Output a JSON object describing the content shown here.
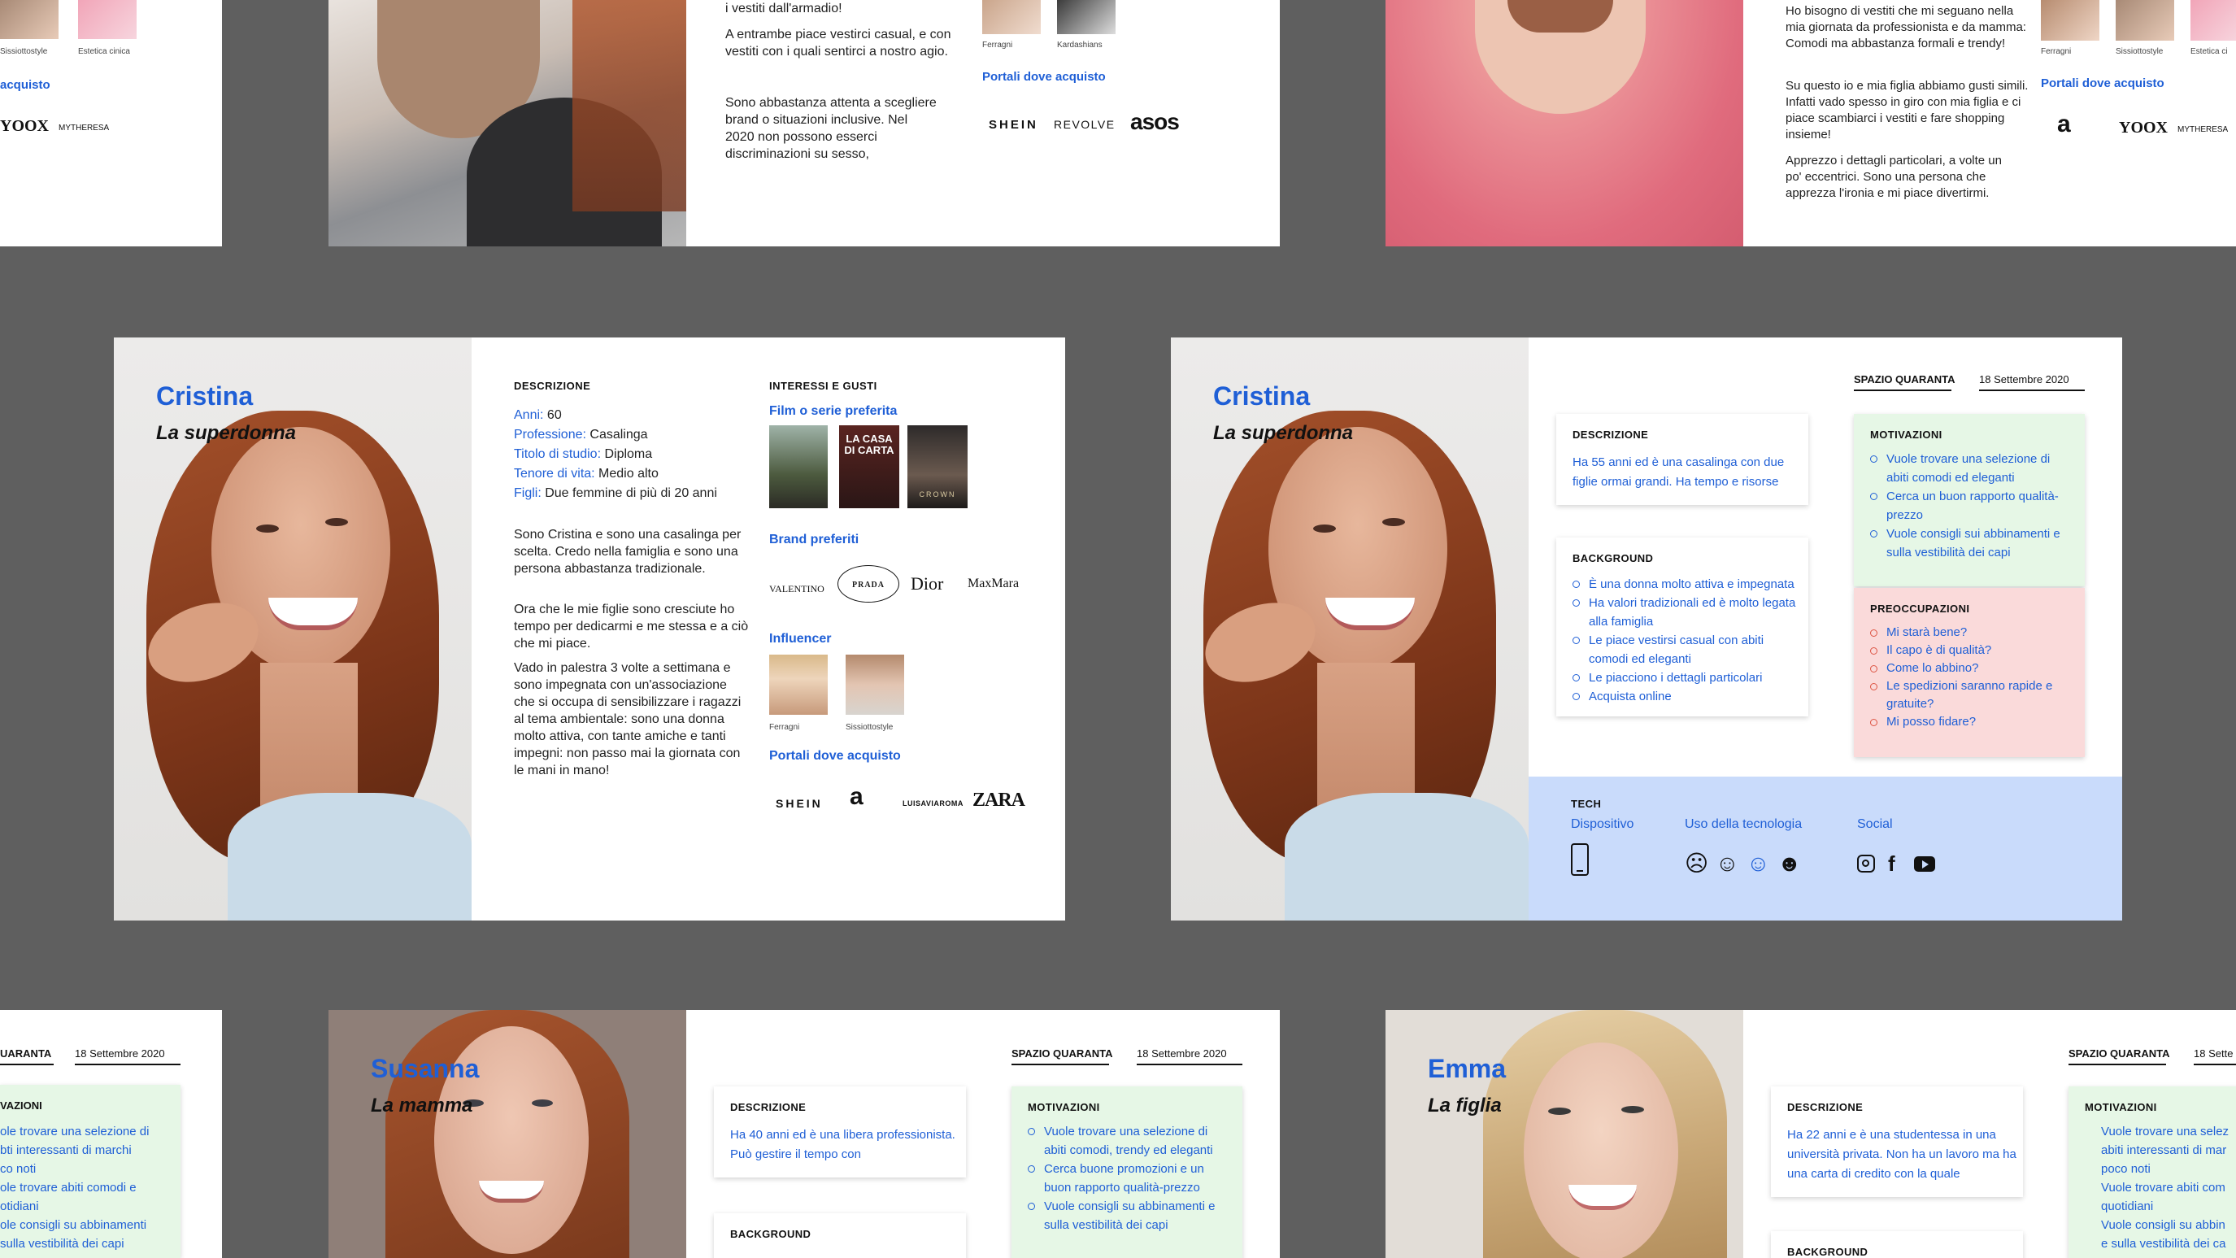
{
  "top_left": {
    "caption_1": "Sissiottostyle",
    "caption_2": "Estetica cinica",
    "link": "acquisto",
    "logos": [
      "YOOX",
      "MYTHERESA"
    ]
  },
  "top_mid": {
    "para_1": "i vestiti dall'armadio!",
    "para_2": "A entrambe piace vestirci casual, e con vestiti con i quali sentirci a nostro agio.",
    "para_3": "Sono abbastanza attenta a scegliere brand o situazioni inclusive. Nel 2020 non possono esserci discriminazioni su sesso,",
    "captions": [
      "Ferragni",
      "Kardashians"
    ],
    "link": "Portali dove acquisto",
    "logos": [
      "SHEIN",
      "REVOLVE",
      "asos"
    ]
  },
  "top_right": {
    "para_1": "Ho bisogno di vestiti che mi seguano nella mia giornata da professionista e da mamma: Comodi ma abbastanza formali e trendy!",
    "para_2": "Su questo io e mia figlia abbiamo gusti simili. Infatti vado spesso in giro con mia figlia e ci piace scambiarci i vestiti e fare shopping insieme!",
    "para_3": "Apprezzo i dettagli particolari, a volte un po' eccentrici. Sono una persona che apprezza l'ironia e mi piace divertirmi.",
    "captions": [
      "Ferragni",
      "Sissiottostyle",
      "Estetica ci"
    ],
    "link": "Portali dove acquisto",
    "logos": [
      "a",
      "YOOX",
      "MYTHERESA"
    ]
  },
  "cristina_profile": {
    "name": "Cristina",
    "subtitle": "La superdonna",
    "desc_head": "DESCRIZIONE",
    "fields": [
      {
        "label": "Anni:",
        "value": " 60"
      },
      {
        "label": "Professione:",
        "value": " Casalinga"
      },
      {
        "label": "Titolo di studio:",
        "value": " Diploma"
      },
      {
        "label": "Tenore di vita:",
        "value": " Medio alto"
      },
      {
        "label": "Figli:",
        "value": " Due femmine di più di 20 anni"
      }
    ],
    "bio_1": "Sono Cristina e sono una casalinga per scelta. Credo nella famiglia e sono una persona abbastanza tradizionale.",
    "bio_2": "Ora che le mie figlie sono cresciute ho tempo per dedicarmi e me stessa e a ciò che mi piace.",
    "bio_3": "Vado in palestra 3 volte a settimana e sono impegnata con un'associazione che si occupa di sensibilizzare i ragazzi al tema ambientale: sono una donna molto attiva, con tante amiche e tanti impegni: non passo mai la giornata con le mani in mano!",
    "int_head": "INTERESSI E GUSTI",
    "films_label": "Film o serie preferita",
    "film_2": "LA CASA DI CARTA",
    "film_3": "CROWN",
    "brands_label": "Brand preferiti",
    "brands": [
      "VALENTINO",
      "PRADA",
      "Dior",
      "MaxMara"
    ],
    "influencer_label": "Influencer",
    "influencers": [
      "Ferragni",
      "Sissiottostyle"
    ],
    "portals_label": "Portali dove acquisto",
    "portals": [
      "SHEIN",
      "a",
      "LUISAVIAROMA",
      "ZARA"
    ]
  },
  "cristina_summary": {
    "name": "Cristina",
    "subtitle": "La superdonna",
    "brand": "SPAZIO QUARANTA",
    "date": "18 Settembre 2020",
    "desc_head": "DESCRIZIONE",
    "desc": "Ha 55 anni ed è una casalinga con due figlie ormai grandi. Ha tempo e risorse",
    "bg_head": "BACKGROUND",
    "background": [
      "È una donna molto attiva e impegnata",
      "Ha valori tradizionali ed è molto legata alla famiglia",
      "Le piace vestirsi casual con abiti comodi ed eleganti",
      "Le piacciono i dettagli particolari",
      "Acquista online"
    ],
    "mot_head": "MOTIVAZIONI",
    "motivations": [
      "Vuole trovare una selezione di abiti comodi ed eleganti",
      "Cerca un buon rapporto qualità-prezzo",
      "Vuole consigli sui abbinamenti e sulla vestibilità dei capi"
    ],
    "worry_head": "PREOCCUPAZIONI",
    "worries": [
      "Mi starà bene?",
      "Il capo è di qualità?",
      "Come lo abbino?",
      "Le spedizioni saranno rapide e gratuite?",
      "Mi posso fidare?"
    ],
    "tech_head": "TECH",
    "device_label": "Dispositivo",
    "usage_label": "Uso della tecnologia",
    "social_label": "Social"
  },
  "bottom_left": {
    "brand": "UARANTA",
    "date": "18 Settembre 2020",
    "mot_head": "VAZIONI",
    "items": [
      "ole trovare una selezione di",
      "bti interessanti di marchi",
      "co noti",
      "ole trovare abiti comodi e",
      "otidiani",
      "ole consigli su abbinamenti",
      "sulla vestibilità dei capi"
    ]
  },
  "susanna": {
    "name": "Susanna",
    "subtitle": "La mamma",
    "brand": "SPAZIO QUARANTA",
    "date": "18 Settembre 2020",
    "desc_head": "DESCRIZIONE",
    "desc": "Ha 40 anni ed è una libera professionista. Può gestire il tempo con",
    "bg_head": "BACKGROUND",
    "mot_head": "MOTIVAZIONI",
    "motivations": [
      "Vuole trovare una selezione di abiti comodi, trendy ed eleganti",
      "Cerca buone promozioni e un buon rapporto qualità-prezzo",
      "Vuole consigli su abbinamenti e sulla vestibilità dei capi"
    ]
  },
  "emma": {
    "name": "Emma",
    "subtitle": "La figlia",
    "brand": "SPAZIO QUARANTA",
    "date": "18 Sette",
    "desc_head": "DESCRIZIONE",
    "desc": "Ha 22 anni e è una studentessa in una università privata. Non ha un lavoro ma ha una carta di credito con la quale",
    "bg_head": "BACKGROUND",
    "mot_head": "MOTIVAZIONI",
    "motivations": [
      "Vuole trovare una selez",
      "abiti interessanti di mar",
      "poco noti",
      "Vuole trovare abiti com",
      "quotidiani",
      "Vuole consigli su abbin",
      "e sulla vestibilità dei ca"
    ]
  },
  "colors": {
    "background": "#5f5f5f",
    "accent_blue": "#1f5fd6",
    "motivation_green": "#e6f7e6",
    "worry_pink": "#fadada",
    "tech_blue": "#c9dbfb"
  }
}
